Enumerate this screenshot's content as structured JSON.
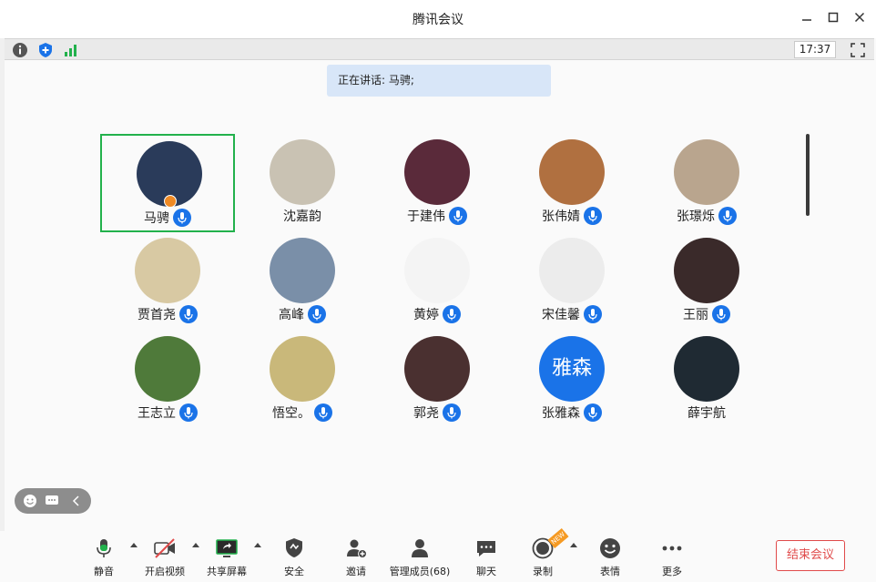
{
  "window": {
    "title": "腾讯会议"
  },
  "toolbar": {
    "time": "17:37"
  },
  "speaking": {
    "text": "正在讲话: 马骋;"
  },
  "participants": [
    {
      "name": "马骋",
      "mic": true,
      "host": true,
      "active": true,
      "color": "#2a3b5a"
    },
    {
      "name": "沈嘉韵",
      "mic": false,
      "color": "#c9c2b3"
    },
    {
      "name": "于建伟",
      "mic": true,
      "color": "#5a2a3a"
    },
    {
      "name": "张伟婧",
      "mic": true,
      "color": "#b07040"
    },
    {
      "name": "张璟烁",
      "mic": true,
      "color": "#b9a58e"
    },
    {
      "name": "贾首尧",
      "mic": true,
      "color": "#d8c9a3"
    },
    {
      "name": "高峰",
      "mic": true,
      "color": "#7a8fa8"
    },
    {
      "name": "黄婷",
      "mic": true,
      "color": "#f4f4f4"
    },
    {
      "name": "宋佳馨",
      "mic": true,
      "color": "#ececec"
    },
    {
      "name": "王丽",
      "mic": true,
      "color": "#3a2a2a"
    },
    {
      "name": "王志立",
      "mic": true,
      "color": "#4f7a3a"
    },
    {
      "name": "悟空。",
      "mic": true,
      "color": "#c9b87a"
    },
    {
      "name": "郭尧",
      "mic": true,
      "color": "#4a3030"
    },
    {
      "name": "张雅森",
      "mic": true,
      "color": "#1a73e8",
      "avatar_text": "雅森"
    },
    {
      "name": "薛宇航",
      "mic": false,
      "color": "#1f2a33"
    }
  ],
  "bottombar": {
    "mute": "静音",
    "video": "开启视频",
    "share": "共享屏幕",
    "security": "安全",
    "invite": "邀请",
    "members": "管理成员(68)",
    "chat": "聊天",
    "record": "录制",
    "new_badge": "NEW",
    "emoji": "表情",
    "more": "更多",
    "end": "结束会议"
  },
  "colors": {
    "accent": "#1a73e8",
    "active_border": "#22b14c",
    "end": "#e04b4b"
  }
}
